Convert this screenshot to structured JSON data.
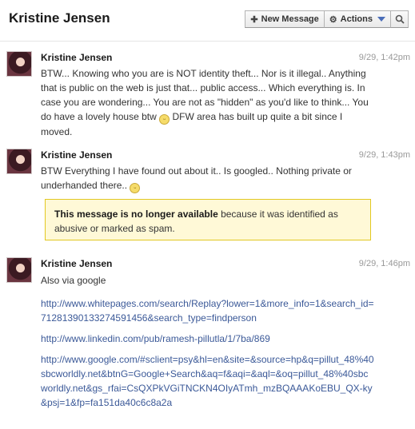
{
  "header": {
    "title": "Kristine Jensen",
    "new_message_label": "New Message",
    "actions_label": "Actions",
    "icons": [
      "plus-icon",
      "gear-icon",
      "caret-down-icon",
      "search-icon"
    ]
  },
  "messages": [
    {
      "sender": "Kristine Jensen",
      "time": "9/29, 1:42pm",
      "text": "BTW... Knowing who you are is NOT identity theft... Nor is it illegal.. Anything that is public on the web is just that... public access... Which everything is. In case you are wondering... You are not as \"hidden\" as you'd like to think... You do have a lovely house btw",
      "text_tail": " DFW area has built up quite a bit since I moved."
    },
    {
      "sender": "Kristine Jensen",
      "time": "9/29, 1:43pm",
      "text": "BTW Everything I have found out about it.. Is googled.. Nothing private or underhanded there.. "
    },
    {
      "sender": "Kristine Jensen",
      "time": "9/29, 1:46pm",
      "text": "Also via google",
      "links": [
        "http://www.whitepages.com/search/Replay?lower=1&more_info=1&search_id=71281390133274591456&search_type=findperson",
        "http://www.linkedin.com/pub/ramesh-pillutla/1/7ba/869",
        "http://www.google.com/#sclient=psy&hl=en&site=&source=hp&q=pillut_48%40sbcworldly.net&btnG=Google+Search&aq=f&aqi=&aql=&oq=pillut_48%40sbcworldly.net&gs_rfai=CsQXPkVGiTNCKN4OIyATmh_mzBQAAAKoEBU_QX-ky&psj=1&fp=fa151da40c6c8a2a"
      ]
    }
  ],
  "notice": {
    "bold": "This message is no longer available",
    "rest": " because it was identified as abusive or marked as spam."
  },
  "colors": {
    "link": "#3b5998",
    "notice_bg": "#fff9d7",
    "notice_border": "#e2c822"
  }
}
